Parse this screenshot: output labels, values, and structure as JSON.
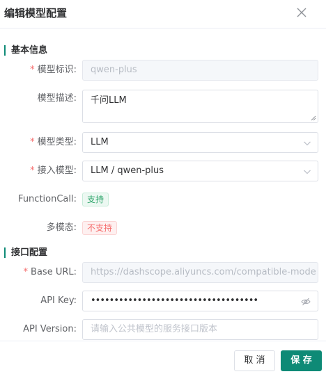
{
  "dialog": {
    "title": "编辑模型配置"
  },
  "sections": {
    "basic": "基本信息",
    "api": "接口配置"
  },
  "fields": {
    "model_id": {
      "label": "模型标识:",
      "value": "qwen-plus",
      "required": true
    },
    "model_desc": {
      "label": "模型描述:",
      "value": "千问LLM",
      "required": false
    },
    "model_type": {
      "label": "模型类型:",
      "value": "LLM",
      "required": true
    },
    "access_model": {
      "label": "接入模型:",
      "value": "LLM / qwen-plus",
      "required": true
    },
    "function_call": {
      "label": "FunctionCall:",
      "tag": "支持"
    },
    "multimodal": {
      "label": "多模态:",
      "tag": "不支持"
    },
    "base_url": {
      "label": "Base URL:",
      "value": "https://dashscope.aliyuncs.com/compatible-mode",
      "required": true
    },
    "api_key": {
      "label": "API Key:",
      "value": "••••••••••••••••••••••••••••••••••••"
    },
    "api_version": {
      "label": "API Version:",
      "placeholder": "请输入公共模型的服务接口版本"
    }
  },
  "footer": {
    "cancel": "取 消",
    "save": "保 存"
  },
  "colors": {
    "accent": "#0e8a76",
    "required": "#f56c6c",
    "success": "#2ea56b",
    "danger": "#f56c6c"
  },
  "icons": {
    "close": "close-icon",
    "select": "chevron-down-icon",
    "password": "eye-off-icon"
  }
}
